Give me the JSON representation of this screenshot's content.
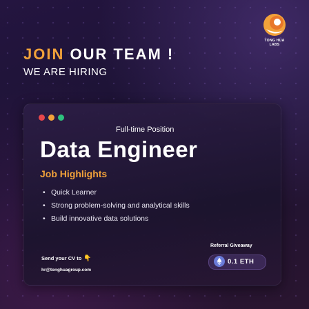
{
  "brand": {
    "name_line1": "TONG HUA",
    "name_line2": "LABS"
  },
  "header": {
    "headline_part1": "JOIN",
    "headline_part2": "OUR TEAM !",
    "subheadline": "WE ARE HIRING"
  },
  "card": {
    "position_type": "Full-time Position",
    "job_title": "Data Engineer",
    "highlights_title": "Job Highlights",
    "highlights": [
      "Quick Learner",
      "Strong problem-solving and analytical skills",
      "Build innovative data solutions"
    ],
    "contact": {
      "label": "Send your CV to",
      "email": "hr@tonghuagroup.com"
    },
    "referral": {
      "label": "Referral Giveaway",
      "amount": "0.1 ETH"
    }
  },
  "icons": {
    "window_dots": [
      "#e8474b",
      "#f2a23a",
      "#2ec27e"
    ],
    "hand": "point-down-icon",
    "eth": "ethereum-icon"
  },
  "colors": {
    "accent": "#f2a23a",
    "background": "#1b1232"
  }
}
